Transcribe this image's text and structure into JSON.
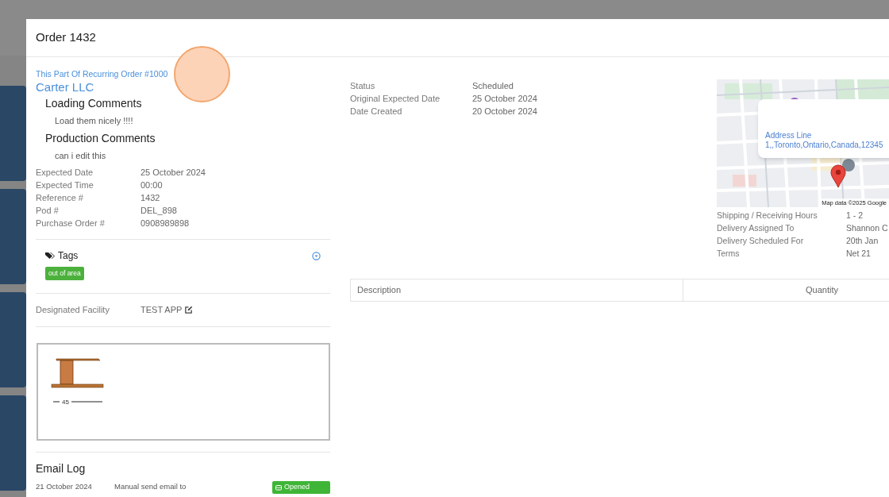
{
  "modal": {
    "title": "Order 1432"
  },
  "recurring_link": "This Part Of Recurring Order #1000",
  "customer": "Carter LLC",
  "comments": [
    {
      "heading": "Loading Comments",
      "text": "Load them nicely !!!!"
    },
    {
      "heading": "Production Comments",
      "text": "can i edit this"
    }
  ],
  "details": [
    {
      "label": "Expected Date",
      "value": "25 October 2024"
    },
    {
      "label": "Expected Time",
      "value": "00:00"
    },
    {
      "label": "Reference #",
      "value": "1432"
    },
    {
      "label": "Pod #",
      "value": "DEL_898"
    },
    {
      "label": "Purchase Order #",
      "value": "0908989898"
    }
  ],
  "tags": {
    "heading": "Tags",
    "items": [
      {
        "label": "out of area"
      }
    ]
  },
  "facility": {
    "label": "Designated Facility",
    "value": "TEST APP"
  },
  "drawing": {
    "dimension": "45"
  },
  "email_log": {
    "title": "Email Log",
    "entries": [
      {
        "date": "21 October 2024",
        "description": "Manual send email to",
        "status": "Opened"
      }
    ]
  },
  "status_details": [
    {
      "label": "Status",
      "value": "Scheduled"
    },
    {
      "label": "Original Expected Date",
      "value": "25 October 2024"
    },
    {
      "label": "Date Created",
      "value": "20 October 2024"
    }
  ],
  "map": {
    "address": "Address Line 1,,Toronto,Ontario,Canada,12345",
    "attribution": "Map data ©2025 Google"
  },
  "shipping_details": [
    {
      "label": "Shipping / Receiving Hours",
      "value": "1 - 2"
    },
    {
      "label": "Delivery Assigned To",
      "value": "Shannon C"
    },
    {
      "label": "Delivery Scheduled For",
      "value": "20th Jan"
    },
    {
      "label": "Terms",
      "value": "Net 21"
    }
  ],
  "items_table": {
    "columns": [
      "Description",
      "Quantity"
    ]
  }
}
